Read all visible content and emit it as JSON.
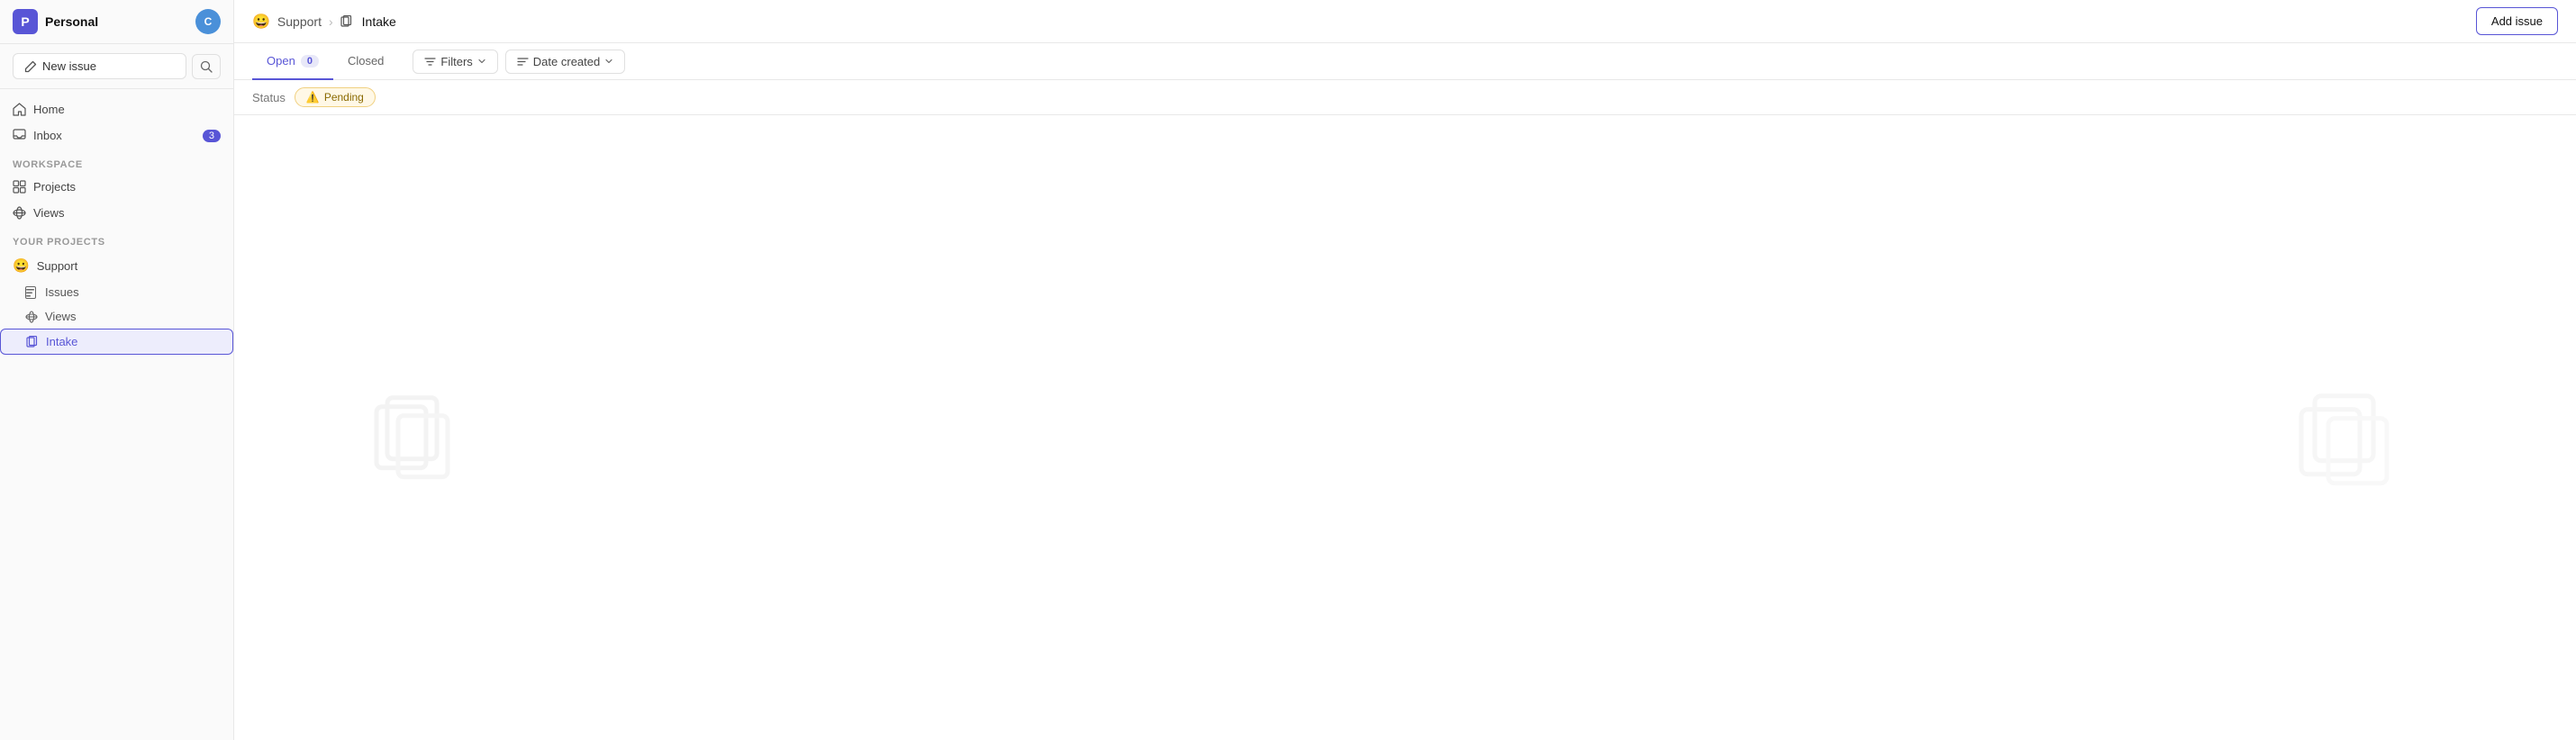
{
  "workspace": {
    "logo_letter": "P",
    "name": "Personal",
    "user_letter": "C"
  },
  "sidebar": {
    "new_issue_label": "New issue",
    "nav_items": [
      {
        "id": "home",
        "label": "Home"
      },
      {
        "id": "inbox",
        "label": "Inbox",
        "badge": "3"
      }
    ],
    "workspace_section": "WORKSPACE",
    "workspace_items": [
      {
        "id": "projects",
        "label": "Projects"
      },
      {
        "id": "views",
        "label": "Views"
      }
    ],
    "your_projects_section": "YOUR PROJECTS",
    "projects": [
      {
        "id": "support",
        "label": "Support",
        "emoji": "😀",
        "children": [
          {
            "id": "issues",
            "label": "Issues"
          },
          {
            "id": "views",
            "label": "Views"
          },
          {
            "id": "intake",
            "label": "Intake",
            "active": true
          }
        ]
      }
    ]
  },
  "header": {
    "breadcrumb_parent": "Support",
    "breadcrumb_current": "Intake",
    "add_issue_label": "Add issue"
  },
  "tabs": [
    {
      "id": "open",
      "label": "Open",
      "count": "0",
      "active": true
    },
    {
      "id": "closed",
      "label": "Closed",
      "active": false
    }
  ],
  "filters": {
    "filters_label": "Filters",
    "date_created_label": "Date created"
  },
  "status_filter": {
    "label": "Status",
    "tag": "Pending"
  }
}
